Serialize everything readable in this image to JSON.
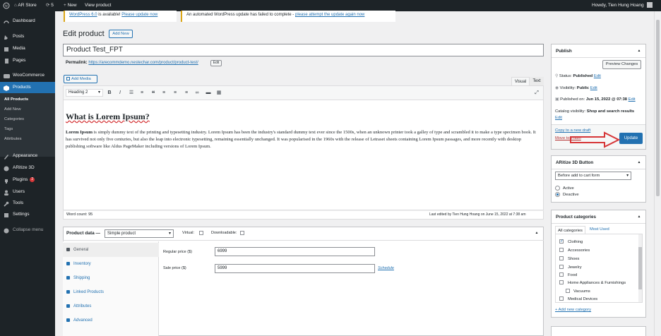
{
  "adminbar": {
    "site": "AR Store",
    "updates": "5",
    "new": "New",
    "view": "View product",
    "howdy": "Howdy, Tien Hung Hoang"
  },
  "sidebar": {
    "items": [
      {
        "label": "Dashboard"
      },
      {
        "label": "Posts"
      },
      {
        "label": "Media"
      },
      {
        "label": "Pages"
      },
      {
        "label": "WooCommerce"
      },
      {
        "label": "Products"
      },
      {
        "label": "Appearance"
      },
      {
        "label": "ARitize 3D"
      },
      {
        "label": "Plugins",
        "badge": "2"
      },
      {
        "label": "Users"
      },
      {
        "label": "Tools"
      },
      {
        "label": "Settings"
      },
      {
        "label": "Collapse menu"
      }
    ],
    "submenu": [
      "All Products",
      "Add New",
      "Categories",
      "Tags",
      "Attributes"
    ]
  },
  "notices": {
    "n1_link": "WordPress 6.0",
    "n1_text": " is available! ",
    "n1_link2": "Please update now",
    "n2_text": "An automated WordPress update has failed to complete - ",
    "n2_link": "please attempt the update again now"
  },
  "header": {
    "title": "Edit product",
    "add_new": "Add New"
  },
  "product": {
    "title": "Product Test_FPT",
    "permalink_label": "Permalink:",
    "permalink_url": "https://arecommdemo.nestechar.com/product/product-test/",
    "edit": "Edit"
  },
  "editor": {
    "add_media": "Add Media",
    "tab_visual": "Visual",
    "tab_text": "Text",
    "format": "Heading 2",
    "heading": "What is Lorem Ipsum?",
    "paragraph_strong": "Lorem Ipsum",
    "paragraph": " is simply dummy text of the printing and typesetting industry. Lorem Ipsum has been the industry's standard dummy text ever since the 1500s, when an unknown printer took a galley of type and scrambled it to make a type specimen book. It has survived not only five centuries, but also the leap into electronic typesetting, remaining essentially unchanged. It was popularised in the 1960s with the release of Letraset sheets containing Lorem Ipsum passages, and more recently with desktop publishing software like Aldus PageMaker including versions of Lorem Ipsum.",
    "word_count": "Word count: 95",
    "last_edited": "Last edited by Tien Hung Hoang on June 15, 2022 at 7:38 am"
  },
  "product_data": {
    "label": "Product data —",
    "type": "Simple product",
    "virtual": "Virtual:",
    "downloadable": "Downloadable:",
    "tabs": [
      "General",
      "Inventory",
      "Shipping",
      "Linked Products",
      "Attributes",
      "Advanced"
    ],
    "regular_label": "Regular price ($)",
    "regular_value": "6999",
    "sale_label": "Sale price ($)",
    "sale_value": "5999",
    "schedule": "Schedule"
  },
  "publish": {
    "title": "Publish",
    "preview": "Preview Changes",
    "status_label": "Status: ",
    "status": "Published",
    "status_edit": "Edit",
    "visibility_label": "Visibility: ",
    "visibility": "Public",
    "visibility_edit": "Edit",
    "published_label": "Published on: ",
    "published": "Jun 15, 2022 @ 07:38",
    "published_edit": "Edit",
    "catalog_label": "Catalog visibility: ",
    "catalog": "Shop and search results",
    "catalog_edit": "Edit",
    "copy": "Copy to a new draft",
    "trash": "Move to Trash",
    "update": "Update"
  },
  "aritize": {
    "title": "ARitize 3D Button",
    "select": "Before add to cart form",
    "active": "Active",
    "deactive": "Deactive"
  },
  "categories": {
    "title": "Product categories",
    "tab_all": "All categories",
    "tab_used": "Most Used",
    "items": [
      "Clothing",
      "Accessories",
      "Shoes",
      "Jewelry",
      "Food",
      "Home Appliances & Furnishings",
      "Vacuums",
      "Medical Devices"
    ],
    "add": "+ Add new category"
  },
  "colors": {
    "accent": "#2271b1",
    "sidebar": "#1d2327",
    "update_btn": "#2271b1",
    "annotation": "#d63638"
  }
}
